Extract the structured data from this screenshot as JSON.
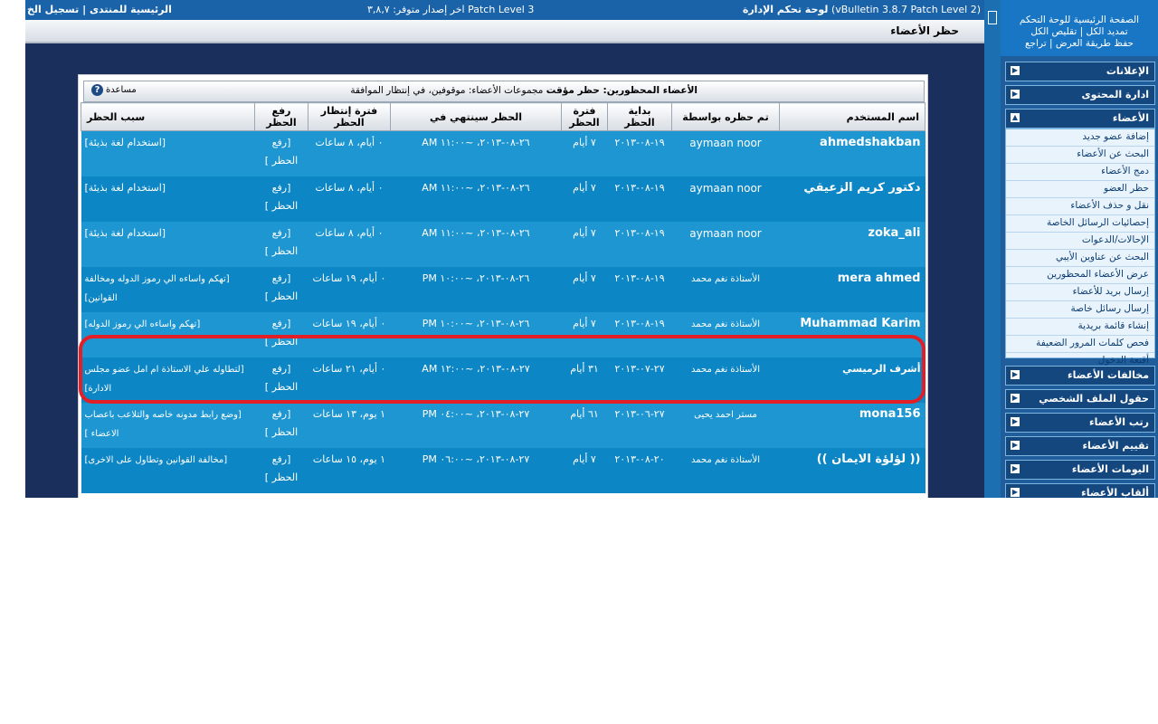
{
  "topbar": {
    "admin_label": "لوحة تحكم الإدارة",
    "version": "(vBulletin 3.8.7 Patch Level 2)",
    "update_notice": "اخر إصدار متوفر: ٣,٨,٧ Patch Level 3",
    "home_link": "الرئيسية للمنتدى",
    "separator": "|",
    "logout_link": "تسجيل الخ"
  },
  "page_title": "حظر الأعضاء",
  "sidebar": {
    "home_link": "الصفحة الرئيسية للوحة التحكم",
    "expand_all": "تمديد الكل",
    "collapse_all": "تقليص الكل",
    "save_view": "حفظ طريقة العرض",
    "revert": "تراجع",
    "sep": "|",
    "groups": [
      {
        "label": "الإعلانات",
        "toggle": "▶"
      },
      {
        "label": "ادارة المحتوى",
        "toggle": "▶"
      },
      {
        "label": "الأعضاء",
        "toggle": "▲"
      },
      {
        "label": "مخالفات الأعضاء",
        "toggle": "▶"
      },
      {
        "label": "حقول الملف الشخصي",
        "toggle": "▶"
      },
      {
        "label": "رتب الأعضاء",
        "toggle": "▶"
      },
      {
        "label": "تقييم الأعضاء",
        "toggle": "▶"
      },
      {
        "label": "اليومات الأعضاء",
        "toggle": "▶"
      },
      {
        "label": "ألقاب الأعضاء",
        "toggle": "▶"
      }
    ],
    "members_items": [
      "إضافة عضو جديد",
      "البحث عن الأعضاء",
      "دمج الأعضاء",
      "حظر العضو",
      "نقل و حذف الأعضاء",
      "إحصائيات الرسائل الخاصة",
      "الإحالات/الدعوات",
      "البحث عن عناوين الأيبي",
      "عرض الأعضاء المحظورين",
      "إرسال بريد للأعضاء",
      "إرسال رسائل خاصة",
      "إنشاء قائمة بريدية",
      "فحص كلمات المرور الضعيفة",
      "أقنعة الدخول"
    ]
  },
  "table": {
    "title_bold": "الأعضاء المحظورين: حظر مؤقت",
    "title_rest": "مجموعات الأعضاء: موقوفين، في إنتظار الموافقة",
    "help": "مساعدة",
    "help_icon": "?",
    "columns": [
      "اسم المستخدم",
      "تم حظره بواسطة",
      "بداية الحظر",
      "فترة الحظر",
      "الحظر سينتهي في",
      "فترة إنتظار الحظر",
      "رفع الحظر",
      "سبب الحظر"
    ],
    "rows": [
      {
        "user": "ahmedshakban",
        "by": "aymaan noor",
        "start": "١٩-٠٨-٢٠١٣",
        "period": "٧ أيام",
        "ends": "٢٦-٠٨-٢٠١٣، ~١١:٠٠ AM",
        "wait": "٠ أيام، ٨ ساعات",
        "lift": "[رفع الحظر ]",
        "reason": "[استخدام لغة بذيئة]"
      },
      {
        "user": "دكتور كريم الزعيقي",
        "by": "aymaan noor",
        "start": "١٩-٠٨-٢٠١٣",
        "period": "٧ أيام",
        "ends": "٢٦-٠٨-٢٠١٣، ~١١:٠٠ AM",
        "wait": "٠ أيام، ٨ ساعات",
        "lift": "[رفع الحظر ]",
        "reason": "[استخدام لغة بذيئة]"
      },
      {
        "user": "zoka_ali",
        "by": "aymaan noor",
        "start": "١٩-٠٨-٢٠١٣",
        "period": "٧ أيام",
        "ends": "٢٦-٠٨-٢٠١٣، ~١١:٠٠ AM",
        "wait": "٠ أيام، ٨ ساعات",
        "lift": "[رفع الحظر ]",
        "reason": "[استخدام لغة بذيئة]"
      },
      {
        "user": "mera ahmed",
        "by": "الأستاذة نغم محمد",
        "start": "١٩-٠٨-٢٠١٣",
        "period": "٧ أيام",
        "ends": "٢٦-٠٨-٢٠١٣، ~١٠:٠٠ PM",
        "wait": "٠ أيام، ١٩ ساعات",
        "lift": "[رفع الحظر ]",
        "reason": "[تهكم واساءه الي رموز الدوله ومخالفة القوانين]"
      },
      {
        "user": "Muhammad Karim",
        "by": "الأستاذة نغم محمد",
        "start": "١٩-٠٨-٢٠١٣",
        "period": "٧ أيام",
        "ends": "٢٦-٠٨-٢٠١٣، ~١٠:٠٠ PM",
        "wait": "٠ أيام، ١٩ ساعات",
        "lift": "[رفع الحظر ]",
        "reason": "[تهكم واساءه الي رموز الدوله]"
      },
      {
        "user": "أشرف الرميسي",
        "by": "الأستاذة نغم محمد",
        "start": "٢٧-٠٧-٢٠١٣",
        "period": "٣١ أيام",
        "ends": "٢٧-٠٨-٢٠١٣، ~١٢:٠٠ AM",
        "wait": "٠ أيام، ٢١ ساعات",
        "lift": "[رفع الحظر ]",
        "reason": "[لتطاوله علي الاستاذة ام امل عضو مجلس الادارة]"
      },
      {
        "user": "mona156",
        "by": "مستر احمد يحيى",
        "start": "٢٧-٠٦-٢٠١٣",
        "period": "٦١ أيام",
        "ends": "٢٧-٠٨-٢٠١٣، ~٠٤:٠٠ PM",
        "wait": "١ يوم، ١٣ ساعات",
        "lift": "[رفع الحظر ]",
        "reason": "[وضع رابط مدونه خاصه والتلاعب باعصاب الاعضاء ]"
      },
      {
        "user": "(( لؤلؤة الايمان ))",
        "by": "الأستاذة نغم محمد",
        "start": "٢٠-٠٨-٢٠١٣",
        "period": "٧ أيام",
        "ends": "٢٧-٠٨-٢٠١٣، ~٠٦:٠٠ PM",
        "wait": "١ يوم، ١٥ ساعات",
        "lift": "[رفع الحظر ]",
        "reason": "[مخالفة القوانين وتطاول على الاخرى]"
      }
    ]
  }
}
